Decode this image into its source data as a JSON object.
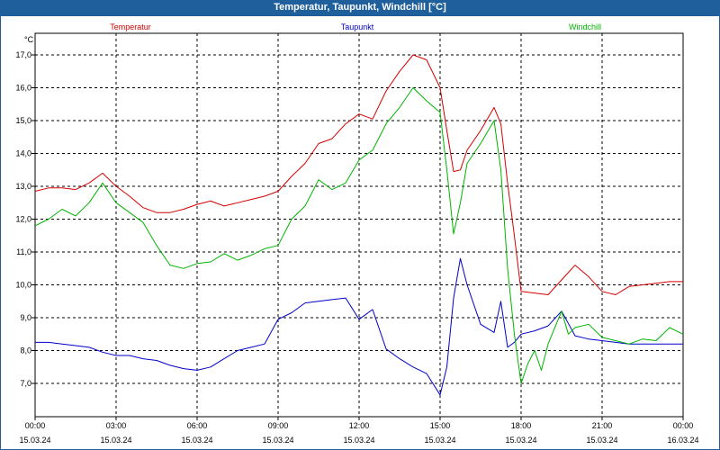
{
  "window": {
    "title": "Temperatur, Taupunkt, Windchill [°C]"
  },
  "chart_data": {
    "type": "line",
    "title": "Temperatur, Taupunkt, Windchill [°C]",
    "ylabel": "°C",
    "ylim": [
      6.3,
      17.6
    ],
    "yticks": [
      "17,0",
      "16,0",
      "15,0",
      "14,0",
      "13,0",
      "12,0",
      "11,0",
      "10,0",
      "9,0",
      "8,0",
      "7,0"
    ],
    "ytick_values": [
      17,
      16,
      15,
      14,
      13,
      12,
      11,
      10,
      9,
      8,
      7
    ],
    "xlim": [
      0,
      24
    ],
    "xticks": [
      {
        "hour": 0,
        "time": "00:00",
        "date": "15.03.24"
      },
      {
        "hour": 3,
        "time": "03:00",
        "date": "15.03.24"
      },
      {
        "hour": 6,
        "time": "06:00",
        "date": "15.03.24"
      },
      {
        "hour": 9,
        "time": "09:00",
        "date": "15.03.24"
      },
      {
        "hour": 12,
        "time": "12:00",
        "date": "15.03.24"
      },
      {
        "hour": 15,
        "time": "15:00",
        "date": "15.03.24"
      },
      {
        "hour": 18,
        "time": "18:00",
        "date": "15.03.24"
      },
      {
        "hour": 21,
        "time": "21:00",
        "date": "15.03.24"
      },
      {
        "hour": 24,
        "time": "00:00",
        "date": "16.03.24"
      }
    ],
    "grid": true,
    "legend_position": "top",
    "series": [
      {
        "name": "Temperatur",
        "color": "#d40000",
        "x": [
          0,
          0.5,
          1,
          1.5,
          2,
          2.5,
          3,
          3.5,
          4,
          4.5,
          5,
          5.5,
          6,
          6.5,
          7,
          7.5,
          8,
          8.5,
          9,
          9.5,
          10,
          10.5,
          11,
          11.5,
          12,
          12.5,
          13,
          13.5,
          14,
          14.5,
          15,
          15.25,
          15.5,
          15.75,
          16,
          16.5,
          17,
          17.25,
          17.5,
          17.75,
          18,
          18.5,
          19,
          19.5,
          20,
          20.5,
          21,
          21.5,
          22,
          22.5,
          23,
          23.5,
          24
        ],
        "y": [
          12.85,
          12.95,
          12.95,
          12.9,
          13.1,
          13.4,
          13.0,
          12.7,
          12.35,
          12.2,
          12.2,
          12.3,
          12.45,
          12.55,
          12.4,
          12.5,
          12.6,
          12.7,
          12.85,
          13.3,
          13.7,
          14.3,
          14.45,
          14.9,
          15.2,
          15.05,
          15.9,
          16.5,
          17.0,
          16.85,
          16.0,
          14.7,
          13.45,
          13.5,
          14.1,
          14.7,
          15.4,
          14.9,
          13.1,
          11.5,
          9.8,
          9.75,
          9.7,
          10.15,
          10.6,
          10.25,
          9.8,
          9.7,
          9.95,
          10.0,
          10.05,
          10.1,
          10.1
        ]
      },
      {
        "name": "Taupunkt",
        "color": "#0000c8",
        "x": [
          0,
          0.5,
          1,
          1.5,
          2,
          2.5,
          3,
          3.5,
          4,
          4.5,
          5,
          5.5,
          6,
          6.5,
          7,
          7.5,
          8,
          8.5,
          9,
          9.5,
          10,
          10.5,
          11,
          11.5,
          12,
          12.5,
          13,
          13.5,
          14,
          14.5,
          15,
          15.25,
          15.5,
          15.75,
          16,
          16.5,
          17,
          17.25,
          17.5,
          17.75,
          18,
          18.5,
          19,
          19.5,
          20,
          20.5,
          21,
          21.5,
          22,
          22.5,
          23,
          23.5,
          24
        ],
        "y": [
          8.25,
          8.25,
          8.2,
          8.15,
          8.1,
          7.95,
          7.85,
          7.85,
          7.75,
          7.7,
          7.55,
          7.45,
          7.4,
          7.5,
          7.75,
          8.0,
          8.1,
          8.2,
          8.95,
          9.15,
          9.45,
          9.5,
          9.55,
          9.6,
          8.95,
          9.25,
          8.05,
          7.75,
          7.5,
          7.3,
          6.65,
          7.5,
          9.6,
          10.8,
          10.0,
          8.8,
          8.55,
          9.5,
          8.1,
          8.25,
          8.5,
          8.6,
          8.75,
          9.2,
          8.45,
          8.35,
          8.3,
          8.25,
          8.2,
          8.2,
          8.2,
          8.2,
          8.2
        ]
      },
      {
        "name": "Windchill",
        "color": "#00b400",
        "x": [
          0,
          0.5,
          1,
          1.5,
          2,
          2.5,
          3,
          3.5,
          4,
          4.5,
          5,
          5.5,
          6,
          6.5,
          7,
          7.5,
          8,
          8.5,
          9,
          9.5,
          10,
          10.5,
          11,
          11.5,
          12,
          12.5,
          13,
          13.5,
          14,
          14.5,
          15,
          15.25,
          15.5,
          15.75,
          16,
          16.5,
          17,
          17.25,
          17.5,
          17.75,
          18,
          18.25,
          18.5,
          18.75,
          19,
          19.5,
          19.75,
          20,
          20.5,
          21,
          21.5,
          22,
          22.5,
          23,
          23.5,
          24
        ],
        "y": [
          11.8,
          12.0,
          12.3,
          12.1,
          12.5,
          13.1,
          12.5,
          12.2,
          11.9,
          11.2,
          10.6,
          10.5,
          10.65,
          10.7,
          10.95,
          10.75,
          10.9,
          11.1,
          11.2,
          12.0,
          12.4,
          13.2,
          12.9,
          13.1,
          13.8,
          14.1,
          14.9,
          15.4,
          16.0,
          15.6,
          15.25,
          13.5,
          11.55,
          12.5,
          13.7,
          14.3,
          15.0,
          13.5,
          10.5,
          8.5,
          7.0,
          7.6,
          8.0,
          7.4,
          8.2,
          9.2,
          8.5,
          8.7,
          8.8,
          8.4,
          8.3,
          8.2,
          8.35,
          8.3,
          8.7,
          8.5
        ]
      }
    ]
  }
}
